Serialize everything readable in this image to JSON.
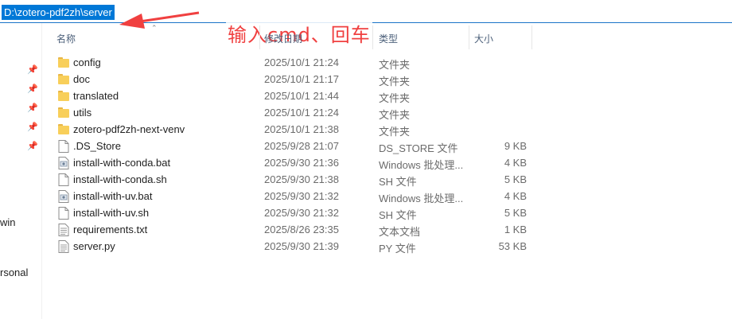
{
  "address_bar": {
    "path": "D:\\zotero-pdf2zh\\server"
  },
  "annotation": {
    "text": "输入cmd、回车",
    "color": "#f04040"
  },
  "columns": {
    "name": "名称",
    "date": "修改日期",
    "type": "类型",
    "size": "大小"
  },
  "nav_pane": {
    "items": [
      "win",
      "rsonal"
    ]
  },
  "colors": {
    "accent": "#0078d7",
    "folder": "#f8cf5a"
  },
  "files": [
    {
      "name": "config",
      "date": "2025/10/1 21:24",
      "type": "文件夹",
      "size": "",
      "icon": "folder-icon"
    },
    {
      "name": "doc",
      "date": "2025/10/1 21:17",
      "type": "文件夹",
      "size": "",
      "icon": "folder-icon"
    },
    {
      "name": "translated",
      "date": "2025/10/1 21:44",
      "type": "文件夹",
      "size": "",
      "icon": "folder-icon"
    },
    {
      "name": "utils",
      "date": "2025/10/1 21:24",
      "type": "文件夹",
      "size": "",
      "icon": "folder-icon"
    },
    {
      "name": "zotero-pdf2zh-next-venv",
      "date": "2025/10/1 21:38",
      "type": "文件夹",
      "size": "",
      "icon": "folder-icon"
    },
    {
      "name": ".DS_Store",
      "date": "2025/9/28 21:07",
      "type": "DS_STORE 文件",
      "size": "9 KB",
      "icon": "file-icon"
    },
    {
      "name": "install-with-conda.bat",
      "date": "2025/9/30 21:36",
      "type": "Windows 批处理...",
      "size": "4 KB",
      "icon": "batch-file-icon"
    },
    {
      "name": "install-with-conda.sh",
      "date": "2025/9/30 21:38",
      "type": "SH 文件",
      "size": "5 KB",
      "icon": "file-icon"
    },
    {
      "name": "install-with-uv.bat",
      "date": "2025/9/30 21:32",
      "type": "Windows 批处理...",
      "size": "4 KB",
      "icon": "batch-file-icon"
    },
    {
      "name": "install-with-uv.sh",
      "date": "2025/9/30 21:32",
      "type": "SH 文件",
      "size": "5 KB",
      "icon": "file-icon"
    },
    {
      "name": "requirements.txt",
      "date": "2025/8/26 23:35",
      "type": "文本文档",
      "size": "1 KB",
      "icon": "text-file-icon"
    },
    {
      "name": "server.py",
      "date": "2025/9/30 21:39",
      "type": "PY 文件",
      "size": "53 KB",
      "icon": "text-file-icon"
    }
  ]
}
